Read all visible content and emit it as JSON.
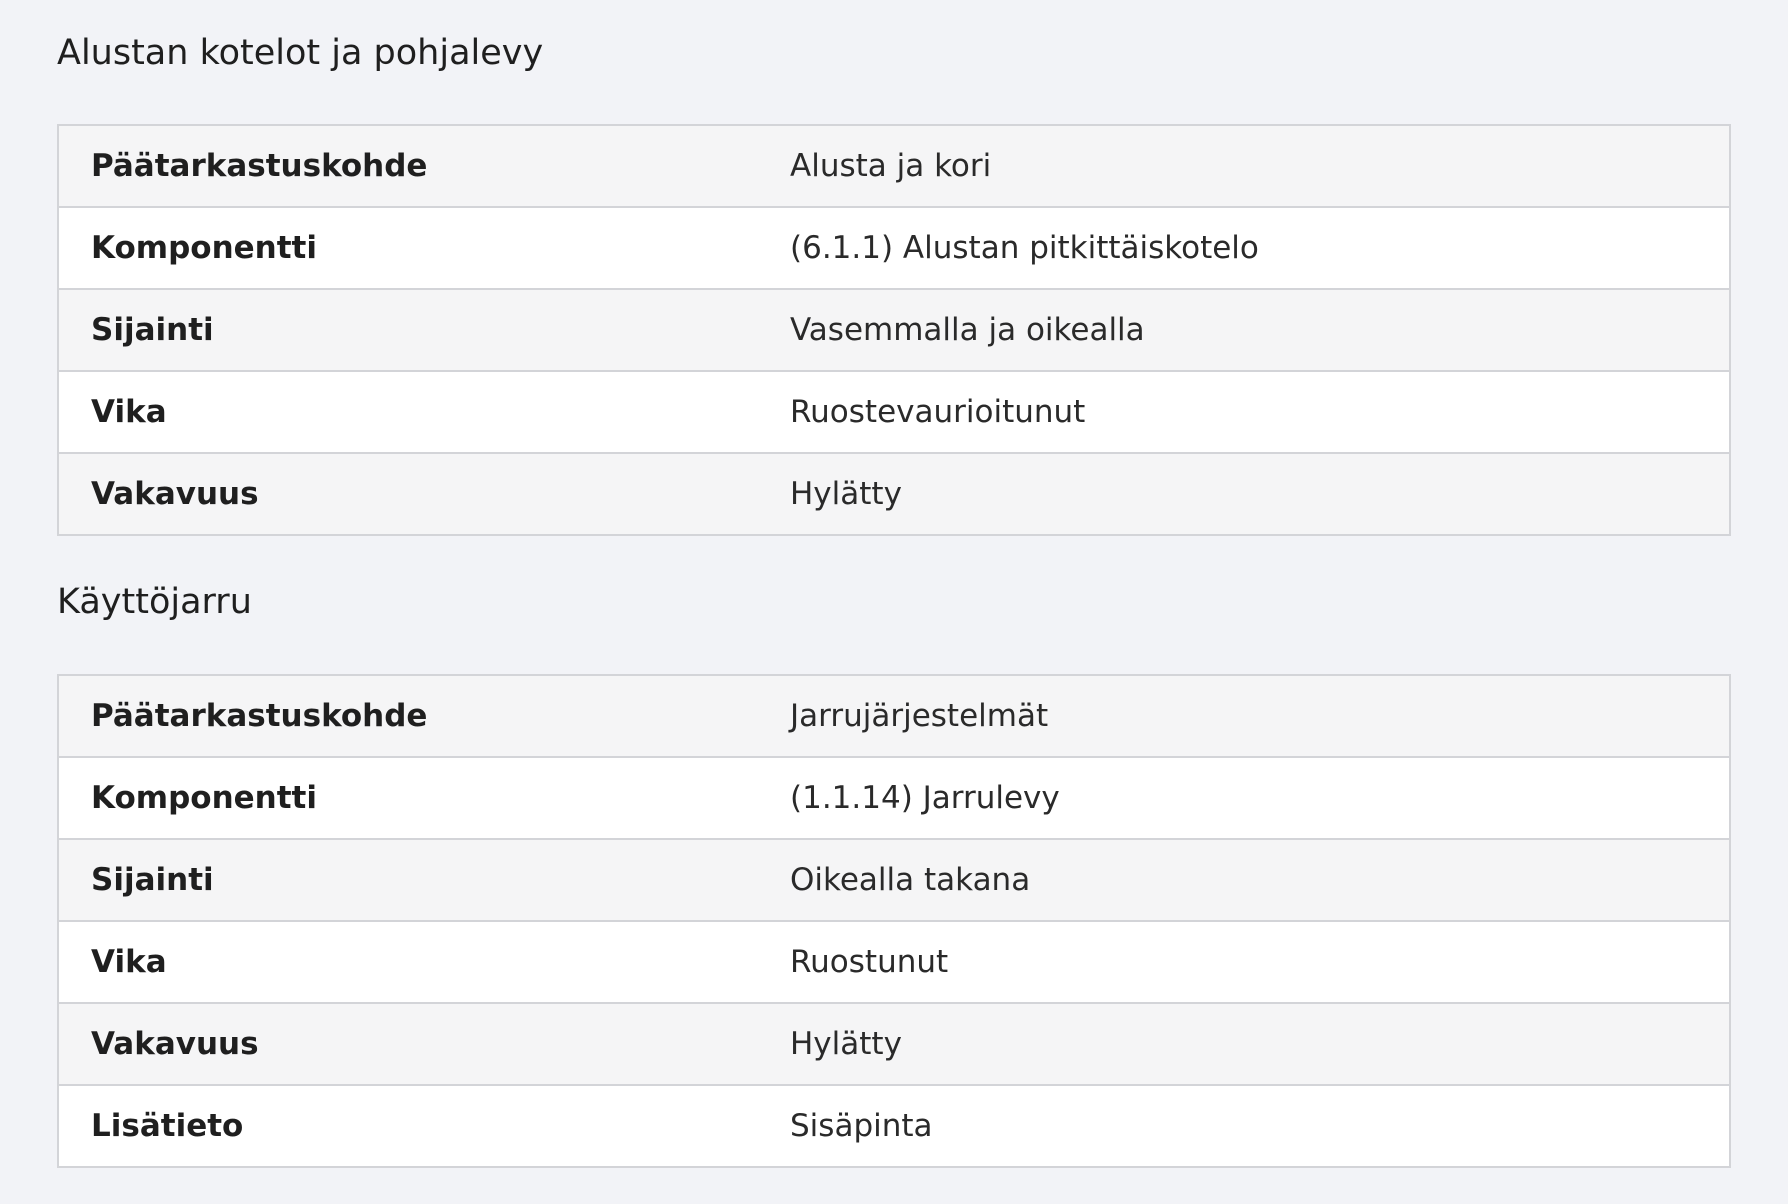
{
  "sections": [
    {
      "title": "Alustan kotelot ja pohjalevy",
      "rows": [
        {
          "label": "Päätarkastuskohde",
          "value": "Alusta ja kori"
        },
        {
          "label": "Komponentti",
          "value": "(6.1.1) Alustan pitkittäiskotelo"
        },
        {
          "label": "Sijainti",
          "value": "Vasemmalla ja oikealla"
        },
        {
          "label": "Vika",
          "value": "Ruostevaurioitunut"
        },
        {
          "label": "Vakavuus",
          "value": "Hylätty"
        }
      ]
    },
    {
      "title": "Käyttöjarru",
      "rows": [
        {
          "label": "Päätarkastuskohde",
          "value": "Jarrujärjestelmät"
        },
        {
          "label": "Komponentti",
          "value": "(1.1.14) Jarrulevy"
        },
        {
          "label": "Sijainti",
          "value": "Oikealla takana"
        },
        {
          "label": "Vika",
          "value": "Ruostunut"
        },
        {
          "label": "Vakavuus",
          "value": "Hylätty"
        },
        {
          "label": "Lisätieto",
          "value": "Sisäpinta"
        }
      ]
    }
  ]
}
